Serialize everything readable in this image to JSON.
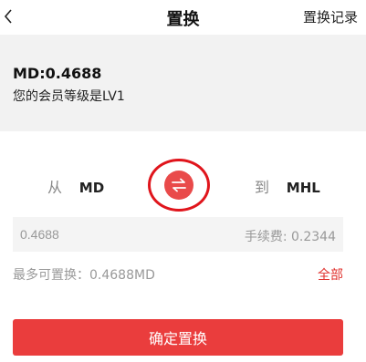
{
  "header": {
    "back_icon": "chevron-left-icon",
    "title": "置换",
    "history_label": "置换记录"
  },
  "account": {
    "balance": "MD:0.4688",
    "level_text": "您的会员等级是LV1"
  },
  "swap": {
    "from_label": "从",
    "from_currency": "MD",
    "to_label": "到",
    "to_currency": "MHL",
    "swap_icon": "swap-arrows-icon"
  },
  "amount": {
    "value": "0.4688",
    "fee_text": "手续费: 0.2344"
  },
  "limits": {
    "max_text": "最多可置换：0.4688MD",
    "all_label": "全部"
  },
  "actions": {
    "confirm_label": "确定置换"
  },
  "colors": {
    "accent": "#ea3d3d",
    "highlight_ring": "#e0151c",
    "panel_bg": "#f2f2f2"
  }
}
